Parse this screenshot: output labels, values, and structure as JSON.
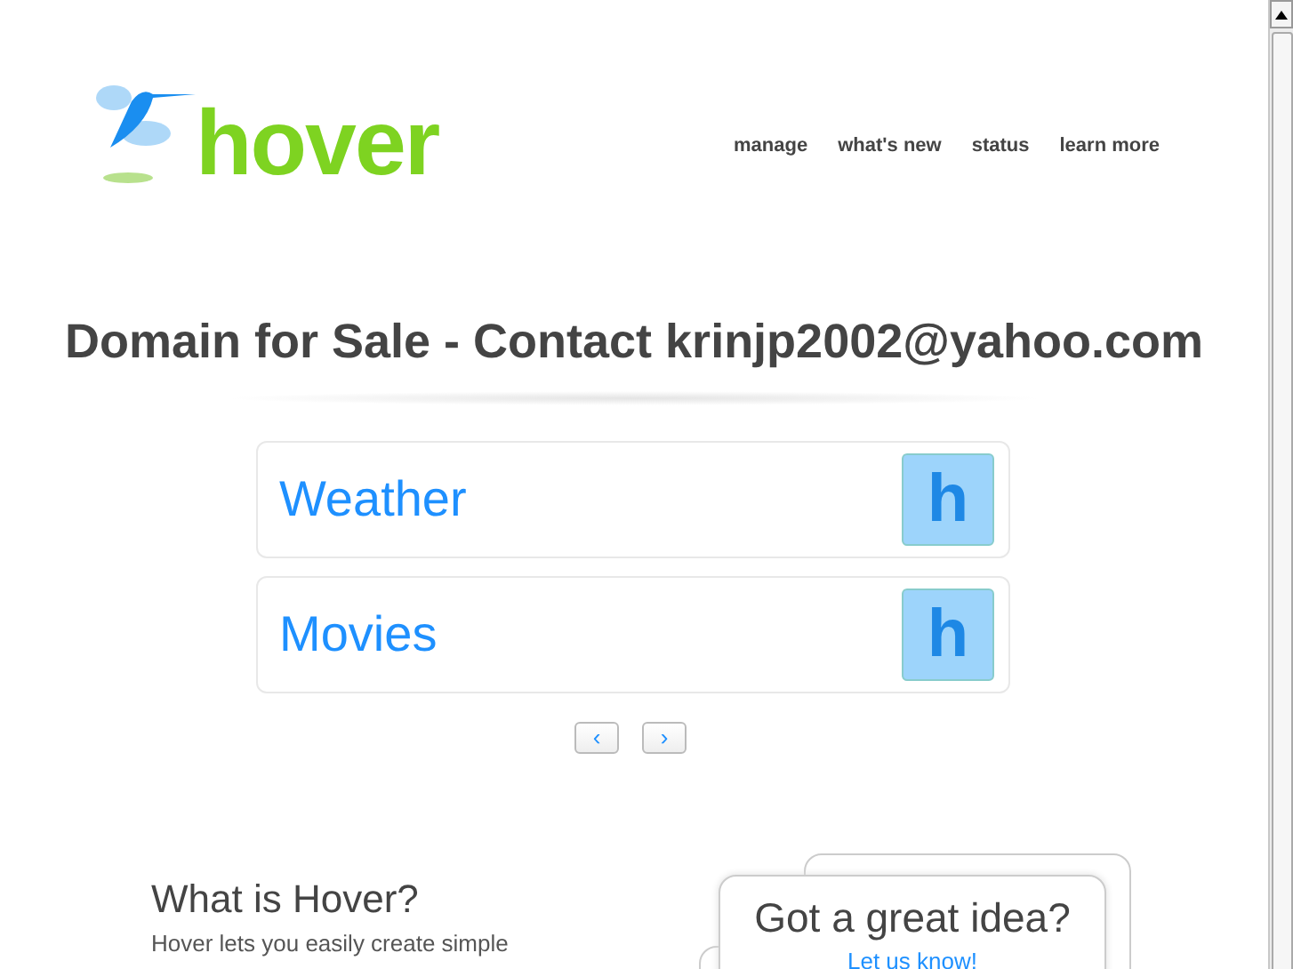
{
  "logo": {
    "wordmark": "hover"
  },
  "nav": [
    {
      "label": "manage"
    },
    {
      "label": "what's new"
    },
    {
      "label": "status"
    },
    {
      "label": "learn more"
    }
  ],
  "headline": "Domain for Sale - Contact krinjp2002@yahoo.com",
  "cards": [
    {
      "label": "Weather",
      "badge": "h"
    },
    {
      "label": "Movies",
      "badge": "h"
    }
  ],
  "pager": {
    "prev": "‹",
    "next": "›"
  },
  "about": {
    "title": "What is Hover?",
    "text": "Hover lets you easily create simple"
  },
  "idea": {
    "title": "Got a great idea?",
    "link": "Let us know!"
  }
}
